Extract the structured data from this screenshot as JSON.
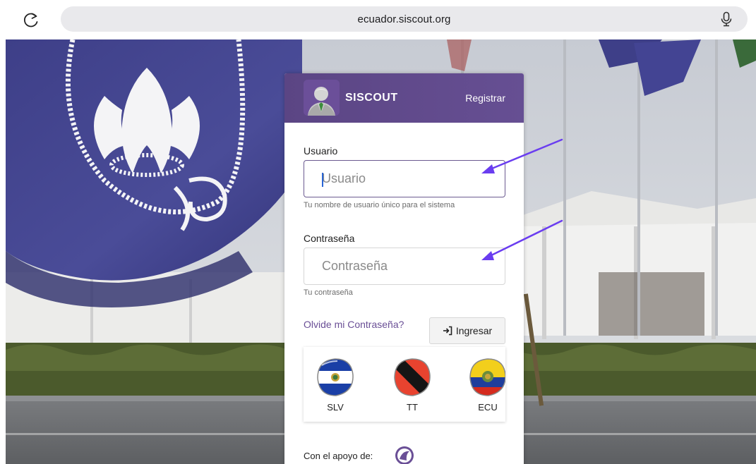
{
  "browser": {
    "url": "ecuador.siscout.org"
  },
  "header": {
    "brand": "SISCOUT",
    "register_label": "Registrar"
  },
  "form": {
    "username": {
      "label": "Usuario",
      "placeholder": "Usuario",
      "value": "",
      "helper": "Tu nombre de usuario único para el sistema"
    },
    "password": {
      "label": "Contraseña",
      "placeholder": "Contraseña",
      "value": "",
      "helper": "Tu contraseña"
    },
    "forgot_label": "Olvide mi Contraseña?",
    "login_label": "Ingresar"
  },
  "countries": [
    {
      "code": "SLV",
      "icon": "el-salvador-flag-icon"
    },
    {
      "code": "TT",
      "icon": "trinidad-tobago-flag-icon"
    },
    {
      "code": "ECU",
      "icon": "ecuador-flag-icon"
    }
  ],
  "footer": {
    "support_label": "Con el apoyo de:"
  },
  "colors": {
    "brand_purple": "#5b4584",
    "link_purple": "#6a4f96",
    "arrow_violet": "#6a3df0"
  }
}
